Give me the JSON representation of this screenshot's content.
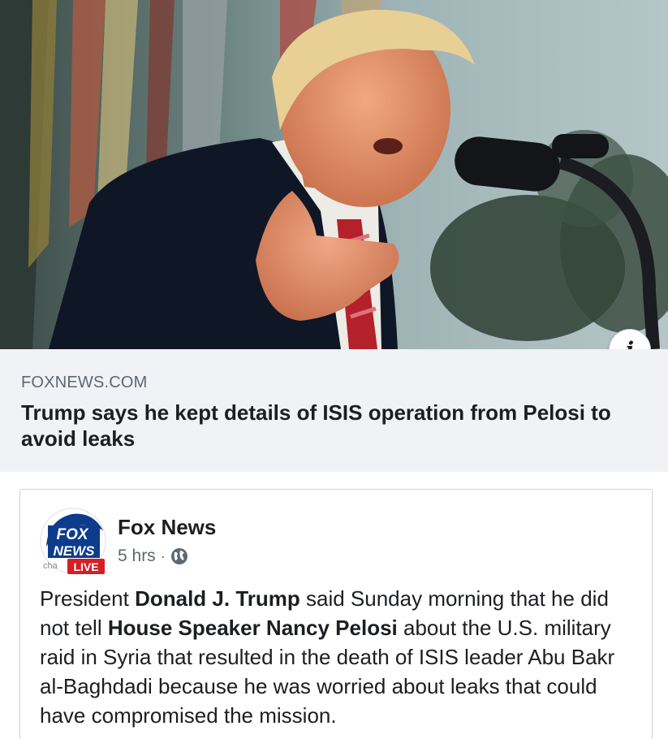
{
  "link_preview": {
    "domain": "FOXNEWS.COM",
    "headline": "Trump says he kept details of ISIS operation from Pelosi to avoid leaks",
    "info_icon": "info-icon",
    "info_glyph": "i"
  },
  "post": {
    "page_name": "Fox News",
    "timestamp": "5 hrs",
    "separator": "·",
    "audience_icon": "globe-icon",
    "avatar": {
      "logo_line1": "FOX",
      "logo_line2": "NEWS",
      "logo_small": "cha",
      "live_badge": "LIVE"
    },
    "body": {
      "t1": "President ",
      "b1": "Donald J. Trump",
      "t2": " said Sunday morning that he did not tell ",
      "b2": "House Speaker Nancy Pelosi",
      "t3": " about the U.S. military raid in Syria that resulted in the death of ISIS leader Abu Bakr al-Baghdadi because he was worried about leaks that could have compromised the mission."
    }
  },
  "colors": {
    "meta_bg": "#f0f2f5",
    "text_primary": "#1c1e21",
    "text_secondary": "#606770",
    "fox_blue": "#0d3c8c",
    "live_red": "#d51e25"
  }
}
